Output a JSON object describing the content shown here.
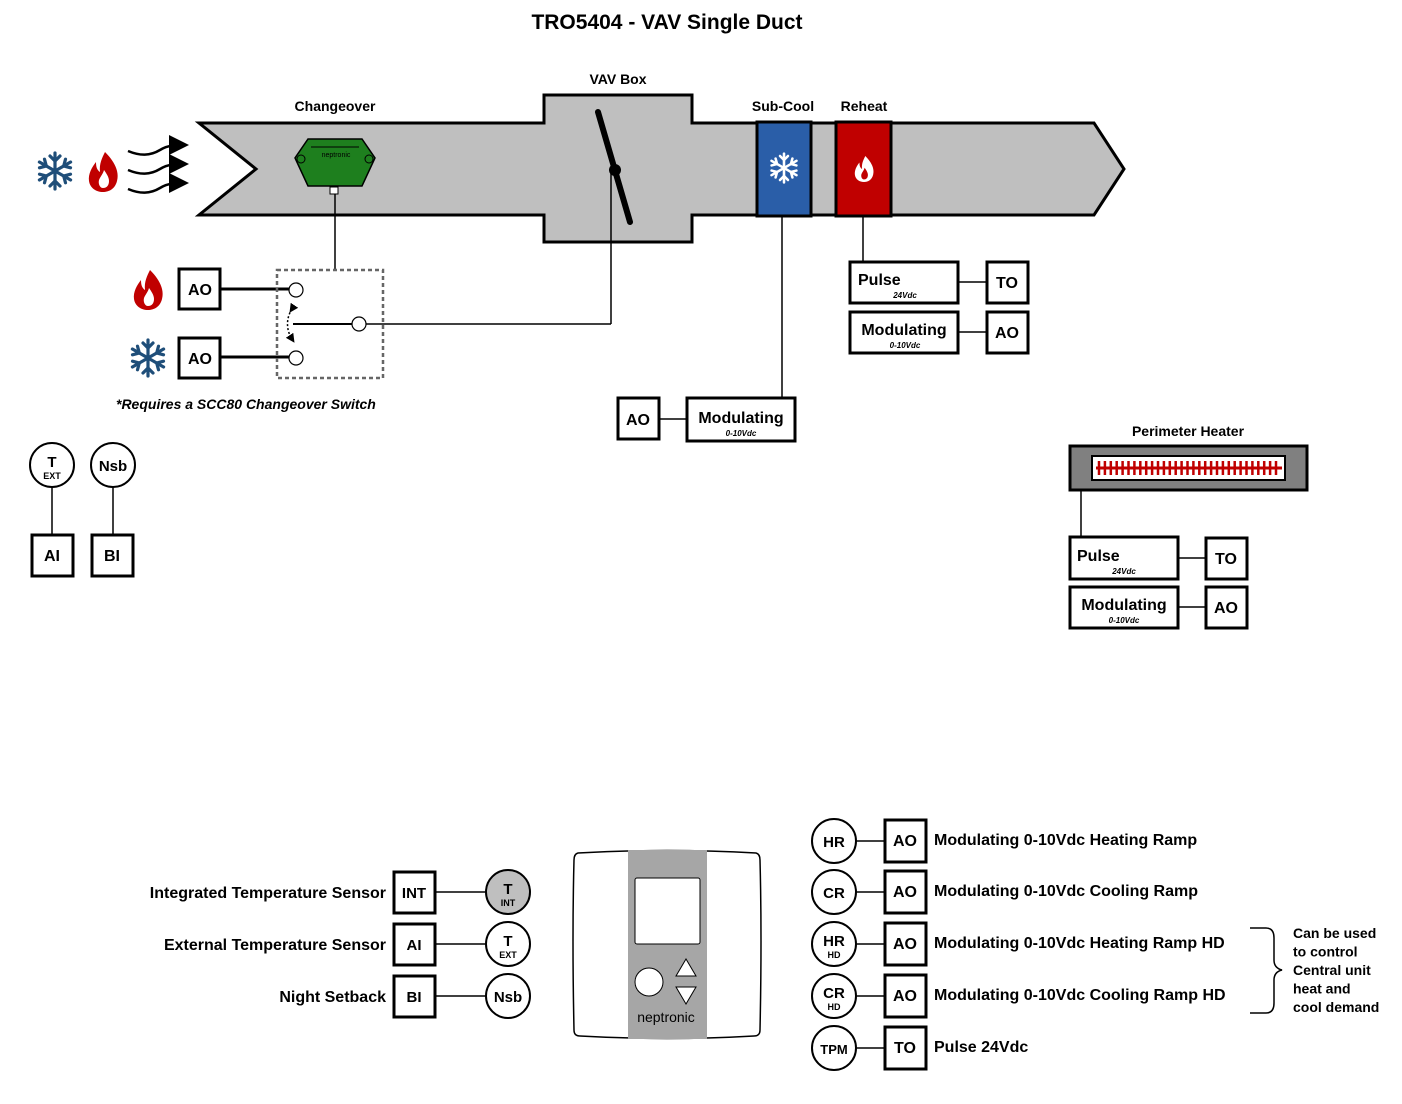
{
  "title": "TRO5404 - VAV Single Duct",
  "duct": {
    "changeover_label": "Changeover",
    "vav_box_label": "VAV Box",
    "subcool_label": "Sub-Cool",
    "reheat_label": "Reheat",
    "sensor_brand": "neptronic",
    "colors": {
      "duct": "#bfbfbf",
      "subcool": "#2a5ea8",
      "reheat": "#c00000",
      "sensor": "#1e7f1e",
      "snow": "#1f4e79",
      "flame": "#c00000"
    }
  },
  "changeover_switch": {
    "heat_output": "AO",
    "cool_output": "AO",
    "note": "*Requires a SCC80 Changeover Switch"
  },
  "subcool_output": {
    "mode": "Modulating",
    "mode_sub": "0-10Vdc",
    "type": "AO"
  },
  "reheat_outputs": [
    {
      "mode": "Pulse",
      "mode_sub": "24Vdc",
      "type": "TO"
    },
    {
      "mode": "Modulating",
      "mode_sub": "0-10Vdc",
      "type": "AO"
    }
  ],
  "perimeter_heater": {
    "label": "Perimeter Heater",
    "outputs": [
      {
        "mode": "Pulse",
        "mode_sub": "24Vdc",
        "type": "TO"
      },
      {
        "mode": "Modulating",
        "mode_sub": "0-10Vdc",
        "type": "AO"
      }
    ]
  },
  "inputs_top": [
    {
      "circle": "T",
      "circle_sub": "EXT",
      "box": "AI"
    },
    {
      "circle": "Nsb",
      "circle_sub": "",
      "box": "BI"
    }
  ],
  "sensors": [
    {
      "label": "Integrated Temperature Sensor",
      "box": "INT",
      "circle": "T",
      "circle_sub": "INT",
      "filled": true
    },
    {
      "label": "External Temperature Sensor",
      "box": "AI",
      "circle": "T",
      "circle_sub": "EXT",
      "filled": false
    },
    {
      "label": "Night Setback",
      "box": "BI",
      "circle": "Nsb",
      "circle_sub": "",
      "filled": false
    }
  ],
  "thermostat": {
    "brand": "neptronic"
  },
  "outputs": [
    {
      "circle": "HR",
      "circle_sub": "",
      "box": "AO",
      "label": "Modulating 0-10Vdc Heating Ramp"
    },
    {
      "circle": "CR",
      "circle_sub": "",
      "box": "AO",
      "label": "Modulating 0-10Vdc Cooling Ramp"
    },
    {
      "circle": "HR",
      "circle_sub": "HD",
      "box": "AO",
      "label": "Modulating 0-10Vdc Heating Ramp HD"
    },
    {
      "circle": "CR",
      "circle_sub": "HD",
      "box": "AO",
      "label": "Modulating 0-10Vdc Cooling Ramp HD"
    },
    {
      "circle": "TPM",
      "circle_sub": "",
      "box": "TO",
      "label": "Pulse 24Vdc"
    }
  ],
  "brace_note": [
    "Can be used",
    "to control",
    "Central unit",
    "heat and",
    "cool demand"
  ]
}
